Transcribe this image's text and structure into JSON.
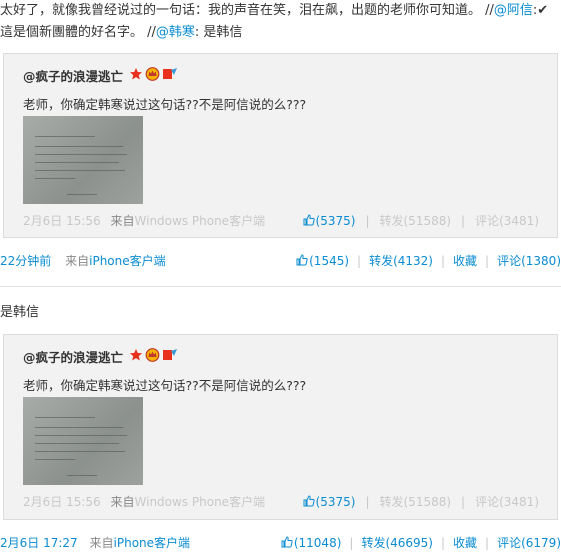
{
  "post1": {
    "text_a": "太好了，就像我曾经说过的一句话：我的声音在笑，泪在飙，出题的老师你可知道。 //",
    "mention1": "@阿信",
    "text_b": ":✔ 這是個新團體的好名字。 //",
    "mention2": "@韩寒",
    "text_c": ": 是韩信",
    "quote": {
      "author": "@疯子的浪漫逃亡",
      "text": "老师，你确定韩寒说过这句话??不是阿信说的么???",
      "time": "2月6日 15:56",
      "source_prefix": "来自",
      "source": "Windows Phone客户端",
      "likes": "(5375)",
      "repost": "转发(51588)",
      "comment": "评论(3481)"
    },
    "footer": {
      "time": "22分钟前",
      "source_prefix": "来自",
      "source": "iPhone客户端",
      "likes": "(1545)",
      "repost": "转发(4132)",
      "favorite": "收藏",
      "comment": "评论(1380)"
    }
  },
  "post2": {
    "text": "是韩信",
    "quote": {
      "author": "@疯子的浪漫逃亡",
      "text": "老师，你确定韩寒说过这句话??不是阿信说的么???",
      "time": "2月6日 15:56",
      "source_prefix": "来自",
      "source": "Windows Phone客户端",
      "likes": "(5375)",
      "repost": "转发(51588)",
      "comment": "评论(3481)"
    },
    "footer": {
      "time": "2月6日 17:27",
      "source_prefix": "来自",
      "source": "iPhone客户端",
      "likes": "(11048)",
      "repost": "转发(46695)",
      "favorite": "收藏",
      "comment": "评论(6179)"
    }
  },
  "icons": [
    "thumbs-up-icon",
    "star-badge-icon",
    "crown-badge-icon",
    "vip-badge-icon"
  ],
  "colors": {
    "link": "#0a8cd2",
    "quote_bg": "#f2f2f2",
    "muted": "#888888"
  }
}
